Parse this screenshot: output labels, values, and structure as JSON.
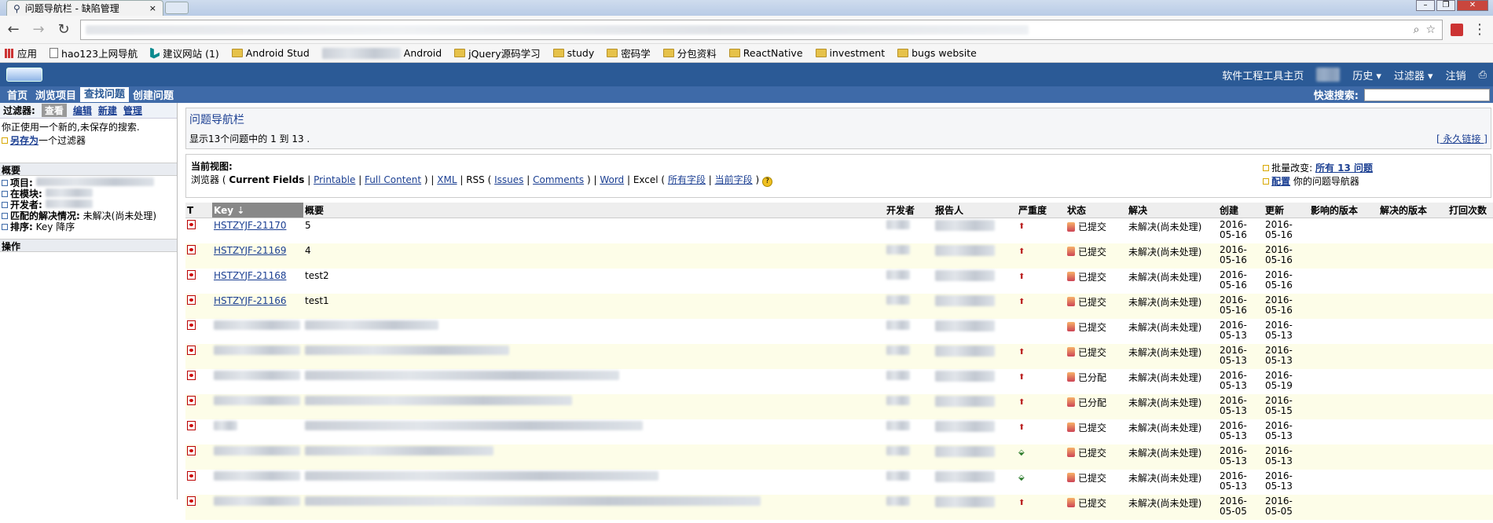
{
  "browser": {
    "tab_title": "问题导航栏 - 缺陷管理",
    "tab_close": "×",
    "bookmarks": [
      "应用",
      "hao123上网导航",
      "建议网站 (1)",
      "Android Stud",
      "Android",
      "jQuery源码学习",
      "study",
      "密码学",
      "分包资料",
      "ReactNative",
      "investment",
      "bugs website"
    ]
  },
  "header": {
    "right_links": [
      "软件工程工具主页",
      "历史 ▾",
      "过滤器 ▾",
      "注销"
    ]
  },
  "menu": {
    "items": [
      "首页",
      "浏览项目",
      "查找问题",
      "创建问题"
    ],
    "quick_search_label": "快速搜索:"
  },
  "sidebar": {
    "filter_label": "过滤器:",
    "filter_tabs": [
      "查看",
      "编辑",
      "新建",
      "管理"
    ],
    "unsaved_note": "你正使用一个新的,未保存的搜索.",
    "save_as_link": "另存为",
    "save_as_suffix": "一个过滤器",
    "overview_title": "概要",
    "summary_items": [
      {
        "label": "项目:",
        "value": ""
      },
      {
        "label": "在模块:",
        "value": ""
      },
      {
        "label": "开发者:",
        "value": ""
      },
      {
        "label": "匹配的解决情况:",
        "value": "未解决(尚未处理)"
      },
      {
        "label": "排序:",
        "value": "Key 降序"
      }
    ],
    "operations_title": "操作"
  },
  "navigator": {
    "title": "问题导航栏",
    "count_text": "显示13个问题中的 1 到 13 .",
    "permalink": "[ 永久链接 ]"
  },
  "views": {
    "current_view_label": "当前视图:",
    "browser": "浏览器 (",
    "current_fields": "Current Fields",
    "printable": "Printable",
    "full_content": "Full Content",
    "xml": "XML",
    "rss": "RSS (",
    "issues": "Issues",
    "comments": "Comments",
    "word": "Word",
    "excel": "Excel (",
    "all_fields": "所有字段",
    "current_fields_cn": "当前字段",
    "bulk_change_label": "批量改变:",
    "bulk_change_link": "所有 13 问题",
    "configure_link": "配置",
    "configure_suffix": "你的问题导航器"
  },
  "table": {
    "headers": [
      "T",
      "Key",
      "概要",
      "开发者",
      "报告人",
      "严重度",
      "状态",
      "解决",
      "创建",
      "更新",
      "影响的版本",
      "解决的版本",
      "打回次数"
    ],
    "rows": [
      {
        "key": "HSTZYJF-21170",
        "summary": "5",
        "priority": "high",
        "status": "已提交",
        "resolution": "未解决(尚未处理)",
        "created": "2016-05-16",
        "updated": "2016-05-16"
      },
      {
        "key": "HSTZYJF-21169",
        "summary": "4",
        "priority": "high",
        "status": "已提交",
        "resolution": "未解决(尚未处理)",
        "created": "2016-05-16",
        "updated": "2016-05-16"
      },
      {
        "key": "HSTZYJF-21168",
        "summary": "test2",
        "priority": "high",
        "status": "已提交",
        "resolution": "未解决(尚未处理)",
        "created": "2016-05-16",
        "updated": "2016-05-16"
      },
      {
        "key": "HSTZYJF-21166",
        "summary": "test1",
        "priority": "high",
        "status": "已提交",
        "resolution": "未解决(尚未处理)",
        "created": "2016-05-16",
        "updated": "2016-05-16"
      },
      {
        "key": "",
        "summary": "",
        "priority": "none",
        "status": "已提交",
        "resolution": "未解决(尚未处理)",
        "created": "2016-05-13",
        "updated": "2016-05-13"
      },
      {
        "key": "",
        "summary": "",
        "priority": "high",
        "status": "已提交",
        "resolution": "未解决(尚未处理)",
        "created": "2016-05-13",
        "updated": "2016-05-13"
      },
      {
        "key": "",
        "summary": "",
        "priority": "high",
        "status": "已分配",
        "resolution": "未解决(尚未处理)",
        "created": "2016-05-13",
        "updated": "2016-05-19"
      },
      {
        "key": "",
        "summary": "",
        "priority": "high",
        "status": "已分配",
        "resolution": "未解决(尚未处理)",
        "created": "2016-05-13",
        "updated": "2016-05-15"
      },
      {
        "key": "",
        "summary": "",
        "priority": "high",
        "status": "已提交",
        "resolution": "未解决(尚未处理)",
        "created": "2016-05-13",
        "updated": "2016-05-13"
      },
      {
        "key": "",
        "summary": "",
        "priority": "low",
        "status": "已提交",
        "resolution": "未解决(尚未处理)",
        "created": "2016-05-13",
        "updated": "2016-05-13"
      },
      {
        "key": "",
        "summary": "",
        "priority": "low",
        "status": "已提交",
        "resolution": "未解决(尚未处理)",
        "created": "2016-05-13",
        "updated": "2016-05-13"
      },
      {
        "key": "",
        "summary": "",
        "priority": "high",
        "status": "已提交",
        "resolution": "未解决(尚未处理)",
        "created": "2016-05-05",
        "updated": "2016-05-05"
      }
    ]
  }
}
